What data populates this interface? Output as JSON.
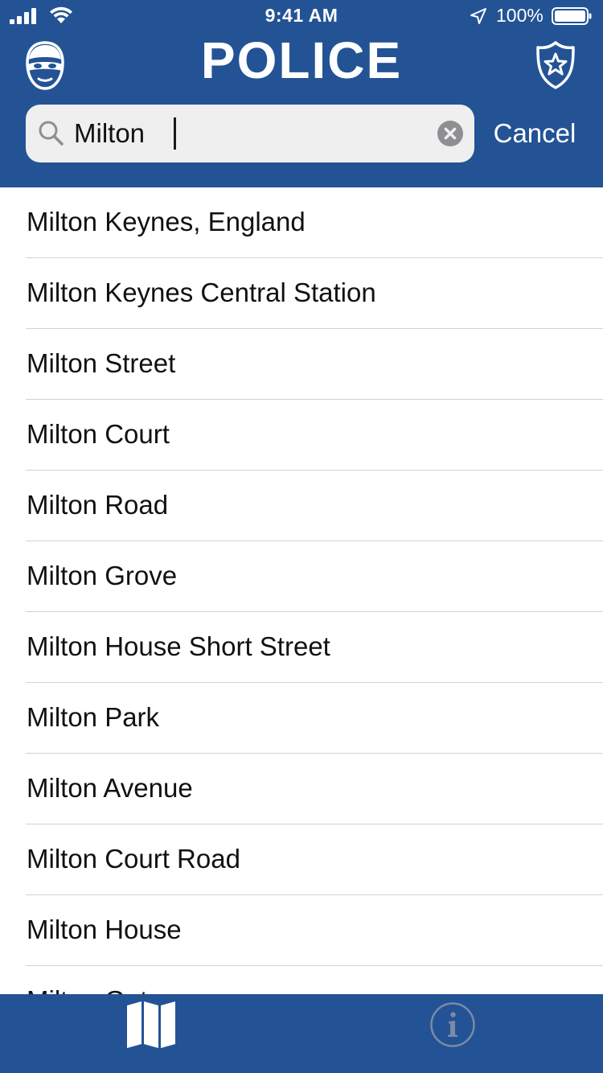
{
  "status_bar": {
    "time": "9:41 AM",
    "battery_percent": "100%"
  },
  "header": {
    "title": "POLICE",
    "left_icon": "bandit-mask-icon",
    "right_icon": "police-badge-star-icon"
  },
  "search": {
    "value": "Milton",
    "placeholder": "",
    "cancel_label": "Cancel"
  },
  "results": [
    {
      "label": "Milton Keynes, England"
    },
    {
      "label": "Milton Keynes Central Station"
    },
    {
      "label": "Milton Street"
    },
    {
      "label": "Milton Court"
    },
    {
      "label": "Milton Road"
    },
    {
      "label": "Milton Grove"
    },
    {
      "label": "Milton House Short Street"
    },
    {
      "label": "Milton Park"
    },
    {
      "label": "Milton Avenue"
    },
    {
      "label": "Milton Court Road"
    },
    {
      "label": "Milton House"
    },
    {
      "label": "Milton Gate"
    }
  ],
  "tab_bar": {
    "tabs": [
      {
        "icon": "map-icon",
        "selected": true
      },
      {
        "icon": "info-icon",
        "selected": false
      }
    ]
  },
  "colors": {
    "brand_blue": "#235395",
    "separator": "#d2d2d6",
    "search_field": "#efefef"
  }
}
